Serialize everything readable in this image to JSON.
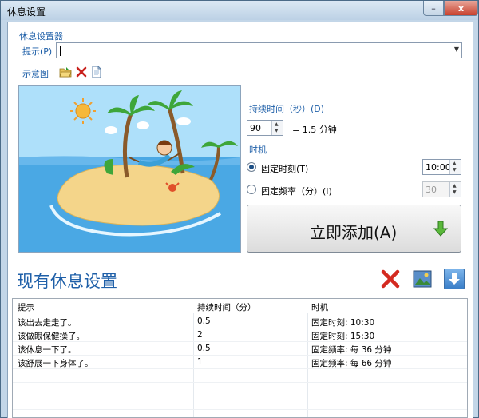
{
  "window": {
    "title": "休息设置",
    "minimize_label": "–",
    "close_label": "x"
  },
  "settings": {
    "group_title": "休息设置器",
    "hint_label": "提示(P)",
    "hint_value": "",
    "preview_label": "示意图",
    "duration_label": "持续时间（秒）(D)",
    "duration_value": "90",
    "duration_equiv": "= 1.5 分钟",
    "timing_label": "时机",
    "fixed_time_label": "固定时刻(T)",
    "fixed_time_value": "10:00",
    "fixed_freq_label": "固定频率（分）(I)",
    "fixed_freq_value": "30",
    "timing_selected": "fixed_time",
    "add_button_label": "立即添加(A)"
  },
  "existing": {
    "title": "现有休息设置",
    "columns": [
      "提示",
      "持续时间（分）",
      "时机"
    ],
    "rows": [
      {
        "hint": "该出去走走了。",
        "duration": "0.5",
        "timing": "固定时刻: 10:30"
      },
      {
        "hint": "该做眼保健操了。",
        "duration": "2",
        "timing": "固定时刻: 15:30"
      },
      {
        "hint": "该休息一下了。",
        "duration": "0.5",
        "timing": "固定频率: 每 36 分钟"
      },
      {
        "hint": "该舒展一下身体了。",
        "duration": "1",
        "timing": "固定频率: 每 66 分钟"
      }
    ]
  },
  "icons": {
    "open": "open-folder-icon",
    "delete": "delete-x-icon",
    "file": "document-icon",
    "add_arrow": "green-down-arrow-icon",
    "delete_all": "red-x-icon",
    "image": "picture-icon",
    "download": "blue-down-arrow-icon"
  },
  "colors": {
    "accent": "#1e5fa8",
    "sky": "#a8d8f4",
    "sea": "#4aa4e0",
    "sand": "#f5d98a"
  }
}
